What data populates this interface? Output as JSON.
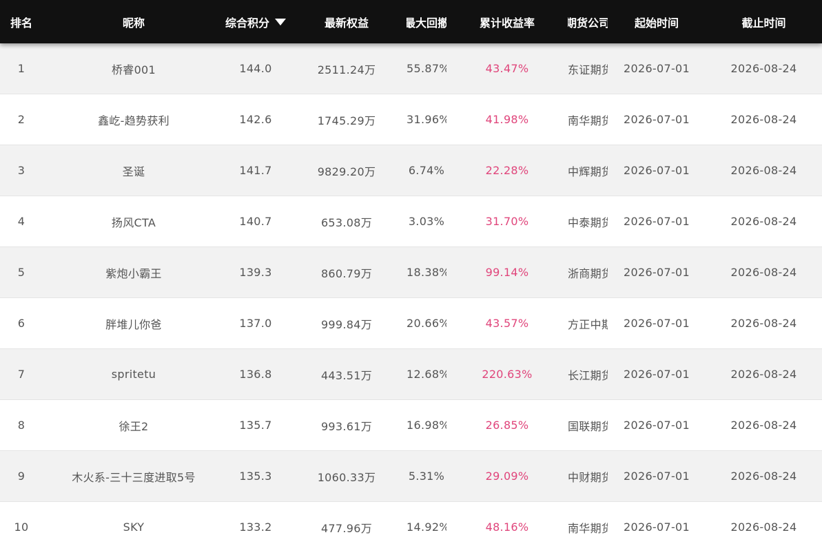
{
  "headers": {
    "rank": "排名",
    "nickname": "昵称",
    "score": "综合积分",
    "equity": "最新权益",
    "drawdown": "最大回撤",
    "return": "累计收益率",
    "company": "期货公司",
    "start": "起始时间",
    "end": "截止时间"
  },
  "icons": {
    "sort": "sort-desc-icon"
  },
  "colors": {
    "header_bg": "#111111",
    "return_text": "#e0457b",
    "row_alt": "#f2f2f2"
  },
  "rows": [
    {
      "rank": "1",
      "nickname": "桥睿001",
      "score": "144.0",
      "equity": "2511.24万",
      "drawdown": "55.87%",
      "return": "43.47%",
      "company": "东证期货",
      "start": "2026-07-01",
      "end": "2026-08-24"
    },
    {
      "rank": "2",
      "nickname": "鑫屹-趋势获利",
      "score": "142.6",
      "equity": "1745.29万",
      "drawdown": "31.96%",
      "return": "41.98%",
      "company": "南华期货",
      "start": "2026-07-01",
      "end": "2026-08-24"
    },
    {
      "rank": "3",
      "nickname": "圣诞",
      "score": "141.7",
      "equity": "9829.20万",
      "drawdown": "6.74%",
      "return": "22.28%",
      "company": "中辉期货",
      "start": "2026-07-01",
      "end": "2026-08-24"
    },
    {
      "rank": "4",
      "nickname": "扬风CTA",
      "score": "140.7",
      "equity": "653.08万",
      "drawdown": "3.03%",
      "return": "31.70%",
      "company": "中泰期货",
      "start": "2026-07-01",
      "end": "2026-08-24"
    },
    {
      "rank": "5",
      "nickname": "紫炮小霸王",
      "score": "139.3",
      "equity": "860.79万",
      "drawdown": "18.38%",
      "return": "99.14%",
      "company": "浙商期货",
      "start": "2026-07-01",
      "end": "2026-08-24"
    },
    {
      "rank": "6",
      "nickname": "胖堆儿你爸",
      "score": "137.0",
      "equity": "999.84万",
      "drawdown": "20.66%",
      "return": "43.57%",
      "company": "方正中期",
      "start": "2026-07-01",
      "end": "2026-08-24"
    },
    {
      "rank": "7",
      "nickname": "spritetu",
      "score": "136.8",
      "equity": "443.51万",
      "drawdown": "12.68%",
      "return": "220.63%",
      "company": "长江期货",
      "start": "2026-07-01",
      "end": "2026-08-24"
    },
    {
      "rank": "8",
      "nickname": "徐王2",
      "score": "135.7",
      "equity": "993.61万",
      "drawdown": "16.98%",
      "return": "26.85%",
      "company": "国联期货",
      "start": "2026-07-01",
      "end": "2026-08-24"
    },
    {
      "rank": "9",
      "nickname": "木火系-三十三度进取5号",
      "score": "135.3",
      "equity": "1060.33万",
      "drawdown": "5.31%",
      "return": "29.09%",
      "company": "中财期货",
      "start": "2026-07-01",
      "end": "2026-08-24"
    },
    {
      "rank": "10",
      "nickname": "SKY",
      "score": "133.2",
      "equity": "477.96万",
      "drawdown": "14.92%",
      "return": "48.16%",
      "company": "南华期货",
      "start": "2026-07-01",
      "end": "2026-08-24"
    }
  ]
}
